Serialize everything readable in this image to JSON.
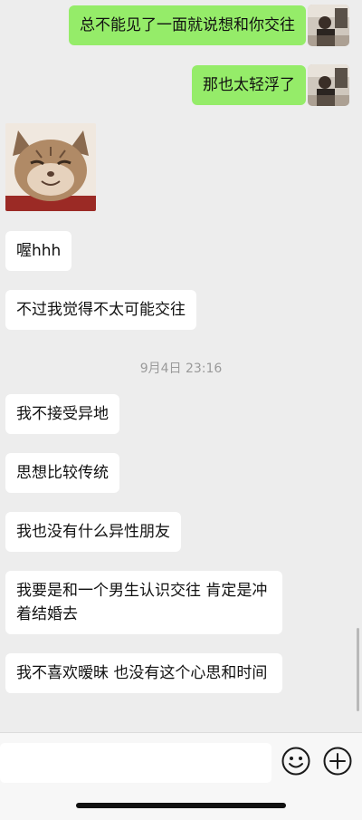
{
  "messages": [
    {
      "side": "out",
      "text": "总不能见了一面就说想和你交往"
    },
    {
      "side": "out",
      "text": "那也太轻浮了"
    },
    {
      "side": "in",
      "type": "sticker",
      "sticker": "smiling-cat"
    },
    {
      "side": "in",
      "text": "喔hhh"
    },
    {
      "side": "in",
      "text": "不过我觉得不太可能交往"
    },
    {
      "side": "in",
      "text": "我不接受异地"
    },
    {
      "side": "in",
      "text": "思想比较传统"
    },
    {
      "side": "in",
      "text": "我也没有什么异性朋友"
    },
    {
      "side": "in",
      "text": "我要是和一个男生认识交往 肯定是冲着结婚去"
    },
    {
      "side": "in",
      "text": "我不喜欢暧昧 也没有这个心思和时间"
    }
  ],
  "timestamp": "9月4日 23:16",
  "input": {
    "value": ""
  },
  "icons": {
    "emoji": "emoji-icon",
    "more": "plus-icon"
  },
  "colors": {
    "outgoing_bubble": "#95ec69",
    "incoming_bubble": "#ffffff",
    "background": "#ededed"
  }
}
